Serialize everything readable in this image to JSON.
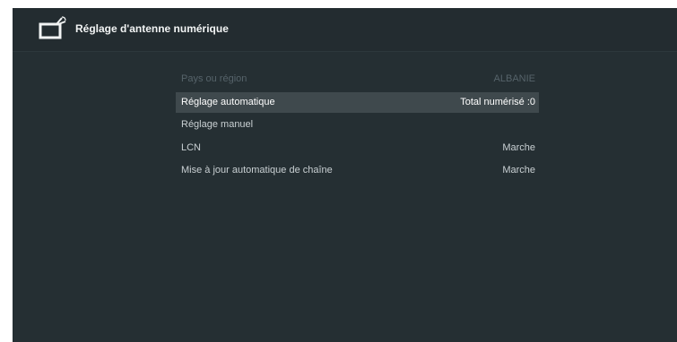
{
  "header": {
    "title": "Réglage d'antenne numérique",
    "icon": "tv-antenna-icon"
  },
  "menu": {
    "items": [
      {
        "label": "Pays ou région",
        "value": "ALBANIE",
        "state": "disabled"
      },
      {
        "label": "Réglage automatique",
        "value": "Total numérisé :0",
        "state": "selected"
      },
      {
        "label": "Réglage manuel",
        "value": "",
        "state": "normal"
      },
      {
        "label": "LCN",
        "value": "Marche",
        "state": "normal"
      },
      {
        "label": "Mise à jour automatique de chaîne",
        "value": "Marche",
        "state": "normal"
      }
    ]
  },
  "colors": {
    "background": "#252f33",
    "header_background": "#232c30",
    "selected_row": "#3f494d",
    "disabled_text": "#56636a",
    "normal_text": "#c9d0d3"
  }
}
